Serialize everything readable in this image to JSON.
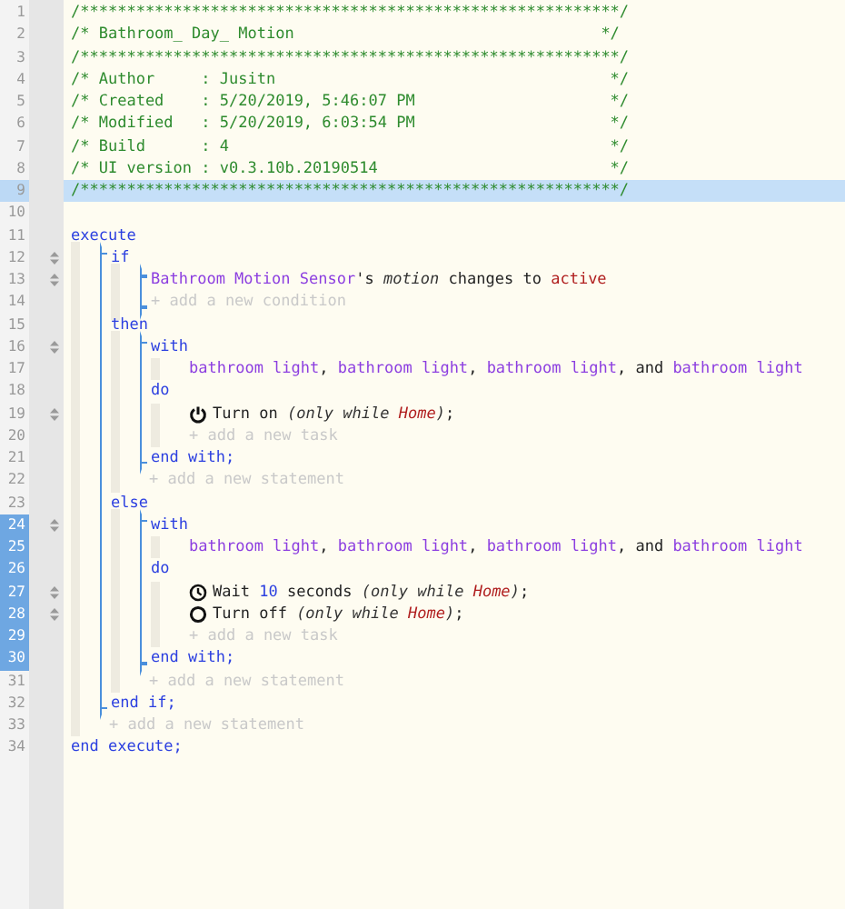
{
  "gutter": [
    {
      "number": "1",
      "selected": false,
      "highlighted": false,
      "grip": false
    },
    {
      "number": "2",
      "selected": false,
      "highlighted": false,
      "grip": false
    },
    {
      "number": "3",
      "selected": false,
      "highlighted": false,
      "grip": false
    },
    {
      "number": "4",
      "selected": false,
      "highlighted": false,
      "grip": false
    },
    {
      "number": "5",
      "selected": false,
      "highlighted": false,
      "grip": false
    },
    {
      "number": "6",
      "selected": false,
      "highlighted": false,
      "grip": false
    },
    {
      "number": "7",
      "selected": false,
      "highlighted": false,
      "grip": false
    },
    {
      "number": "8",
      "selected": false,
      "highlighted": false,
      "grip": false
    },
    {
      "number": "9",
      "selected": false,
      "highlighted": true,
      "grip": false
    },
    {
      "number": "10",
      "selected": false,
      "highlighted": false,
      "grip": false
    },
    {
      "number": "11",
      "selected": false,
      "highlighted": false,
      "grip": false
    },
    {
      "number": "12",
      "selected": false,
      "highlighted": false,
      "grip": true
    },
    {
      "number": "13",
      "selected": false,
      "highlighted": false,
      "grip": true
    },
    {
      "number": "14",
      "selected": false,
      "highlighted": false,
      "grip": false
    },
    {
      "number": "15",
      "selected": false,
      "highlighted": false,
      "grip": false
    },
    {
      "number": "16",
      "selected": false,
      "highlighted": false,
      "grip": true
    },
    {
      "number": "17",
      "selected": false,
      "highlighted": false,
      "grip": false
    },
    {
      "number": "18",
      "selected": false,
      "highlighted": false,
      "grip": false
    },
    {
      "number": "19",
      "selected": false,
      "highlighted": false,
      "grip": true
    },
    {
      "number": "20",
      "selected": false,
      "highlighted": false,
      "grip": false
    },
    {
      "number": "21",
      "selected": false,
      "highlighted": false,
      "grip": false
    },
    {
      "number": "22",
      "selected": false,
      "highlighted": false,
      "grip": false
    },
    {
      "number": "23",
      "selected": false,
      "highlighted": false,
      "grip": false
    },
    {
      "number": "24",
      "selected": true,
      "highlighted": false,
      "grip": true
    },
    {
      "number": "25",
      "selected": true,
      "highlighted": false,
      "grip": false
    },
    {
      "number": "26",
      "selected": true,
      "highlighted": false,
      "grip": false
    },
    {
      "number": "27",
      "selected": true,
      "highlighted": false,
      "grip": true
    },
    {
      "number": "28",
      "selected": true,
      "highlighted": false,
      "grip": true
    },
    {
      "number": "29",
      "selected": true,
      "highlighted": false,
      "grip": false
    },
    {
      "number": "30",
      "selected": true,
      "highlighted": false,
      "grip": false
    },
    {
      "number": "31",
      "selected": false,
      "highlighted": false,
      "grip": false
    },
    {
      "number": "32",
      "selected": false,
      "highlighted": false,
      "grip": false
    },
    {
      "number": "33",
      "selected": false,
      "highlighted": false,
      "grip": false
    },
    {
      "number": "34",
      "selected": false,
      "highlighted": false,
      "grip": false
    }
  ],
  "header": [
    {
      "text": "/**********************************************************/",
      "highlighted": false
    },
    {
      "text": "/* Bathroom_ Day_ Motion                                 */",
      "highlighted": false
    },
    {
      "text": "/**********************************************************/",
      "highlighted": false
    },
    {
      "text": "/* Author     : Jusitn                                    */",
      "highlighted": false
    },
    {
      "text": "/* Created    : 5/20/2019, 5:46:07 PM                     */",
      "highlighted": false
    },
    {
      "text": "/* Modified   : 5/20/2019, 6:03:54 PM                     */",
      "highlighted": false
    },
    {
      "text": "/* Build      : 4                                         */",
      "highlighted": false
    },
    {
      "text": "/* UI version : v0.3.10b.20190514                         */",
      "highlighted": false
    },
    {
      "text": "/**********************************************************/",
      "highlighted": true
    }
  ],
  "code": [
    {
      "kind": "keyword",
      "segments": [
        {
          "text": "execute",
          "kind": "keyword"
        }
      ]
    },
    {
      "kind": "body",
      "children": [
        {
          "kind": "group",
          "children": [
            {
              "kind": "keyword",
              "segments": [
                {
                  "text": "if",
                  "kind": "keyword"
                }
              ]
            },
            {
              "kind": "body",
              "children": [
                {
                  "kind": "group",
                  "children": [
                    {
                      "kind": "statement",
                      "segments": [
                        {
                          "text": "Bathroom Motion Sensor",
                          "kind": "device"
                        },
                        {
                          "text": "'s ",
                          "kind": "plain"
                        },
                        {
                          "text": "motion",
                          "kind": "italic"
                        },
                        {
                          "text": " changes to ",
                          "kind": "plain"
                        },
                        {
                          "text": "active",
                          "kind": "value"
                        }
                      ]
                    },
                    {
                      "kind": "hint",
                      "text": "+ add a new condition"
                    }
                  ]
                }
              ]
            },
            {
              "kind": "keyword",
              "segments": [
                {
                  "text": "then",
                  "kind": "keyword"
                }
              ]
            },
            {
              "kind": "body",
              "children": [
                {
                  "kind": "group",
                  "children": [
                    {
                      "kind": "keyword",
                      "segments": [
                        {
                          "text": "with",
                          "kind": "keyword"
                        }
                      ]
                    },
                    {
                      "kind": "body",
                      "children": [
                        {
                          "kind": "statement",
                          "segments": [
                            {
                              "text": "bathroom light",
                              "kind": "device"
                            },
                            {
                              "text": ", ",
                              "kind": "plain"
                            },
                            {
                              "text": "bathroom light",
                              "kind": "device"
                            },
                            {
                              "text": ", ",
                              "kind": "plain"
                            },
                            {
                              "text": "bathroom light",
                              "kind": "device"
                            },
                            {
                              "text": ", and ",
                              "kind": "plain"
                            },
                            {
                              "text": "bathroom light",
                              "kind": "device"
                            }
                          ]
                        }
                      ]
                    },
                    {
                      "kind": "keyword",
                      "segments": [
                        {
                          "text": "do",
                          "kind": "keyword"
                        }
                      ]
                    },
                    {
                      "kind": "body",
                      "children": [
                        {
                          "kind": "power",
                          "segments": [
                            {
                              "text": "Turn on ",
                              "kind": "plain"
                            },
                            {
                              "text": "(only while ",
                              "kind": "italic"
                            },
                            {
                              "text": "Home",
                              "kind": "emphasis"
                            },
                            {
                              "text": ")",
                              "kind": "italic"
                            },
                            {
                              "text": ";",
                              "kind": "plain"
                            }
                          ]
                        },
                        {
                          "kind": "hint",
                          "text": "+ add a new task"
                        }
                      ]
                    },
                    {
                      "kind": "keyword",
                      "segments": [
                        {
                          "text": "end with;",
                          "kind": "keyword"
                        }
                      ]
                    }
                  ]
                },
                {
                  "kind": "hint",
                  "text": "+ add a new statement"
                }
              ]
            },
            {
              "kind": "keyword",
              "segments": [
                {
                  "text": "else",
                  "kind": "keyword"
                }
              ]
            },
            {
              "kind": "body",
              "children": [
                {
                  "kind": "group",
                  "children": [
                    {
                      "kind": "keyword",
                      "segments": [
                        {
                          "text": "with",
                          "kind": "keyword"
                        }
                      ]
                    },
                    {
                      "kind": "body",
                      "children": [
                        {
                          "kind": "statement",
                          "segments": [
                            {
                              "text": "bathroom light",
                              "kind": "device"
                            },
                            {
                              "text": ", ",
                              "kind": "plain"
                            },
                            {
                              "text": "bathroom light",
                              "kind": "device"
                            },
                            {
                              "text": ", ",
                              "kind": "plain"
                            },
                            {
                              "text": "bathroom light",
                              "kind": "device"
                            },
                            {
                              "text": ", and ",
                              "kind": "plain"
                            },
                            {
                              "text": "bathroom light",
                              "kind": "device"
                            }
                          ]
                        }
                      ]
                    },
                    {
                      "kind": "keyword",
                      "segments": [
                        {
                          "text": "do",
                          "kind": "keyword"
                        }
                      ]
                    },
                    {
                      "kind": "body",
                      "children": [
                        {
                          "kind": "wait",
                          "segments": [
                            {
                              "text": "Wait ",
                              "kind": "plain"
                            },
                            {
                              "text": "10",
                              "kind": "number"
                            },
                            {
                              "text": " seconds ",
                              "kind": "plain"
                            },
                            {
                              "text": "(only while ",
                              "kind": "italic"
                            },
                            {
                              "text": "Home",
                              "kind": "emphasis"
                            },
                            {
                              "text": ")",
                              "kind": "italic"
                            },
                            {
                              "text": ";",
                              "kind": "plain"
                            }
                          ]
                        },
                        {
                          "kind": "off",
                          "segments": [
                            {
                              "text": "Turn off ",
                              "kind": "plain"
                            },
                            {
                              "text": "(only while ",
                              "kind": "italic"
                            },
                            {
                              "text": "Home",
                              "kind": "emphasis"
                            },
                            {
                              "text": ")",
                              "kind": "italic"
                            },
                            {
                              "text": ";",
                              "kind": "plain"
                            }
                          ]
                        },
                        {
                          "kind": "hint",
                          "text": "+ add a new task"
                        }
                      ]
                    },
                    {
                      "kind": "keyword",
                      "segments": [
                        {
                          "text": "end with;",
                          "kind": "keyword"
                        }
                      ]
                    }
                  ]
                },
                {
                  "kind": "hint",
                  "text": "+ add a new statement"
                }
              ]
            },
            {
              "kind": "keyword",
              "segments": [
                {
                  "text": "end if;",
                  "kind": "keyword"
                }
              ]
            }
          ]
        },
        {
          "kind": "hint",
          "text": "+ add a new statement"
        }
      ]
    },
    {
      "kind": "keyword",
      "segments": [
        {
          "text": "end execute;",
          "kind": "keyword"
        }
      ]
    }
  ]
}
